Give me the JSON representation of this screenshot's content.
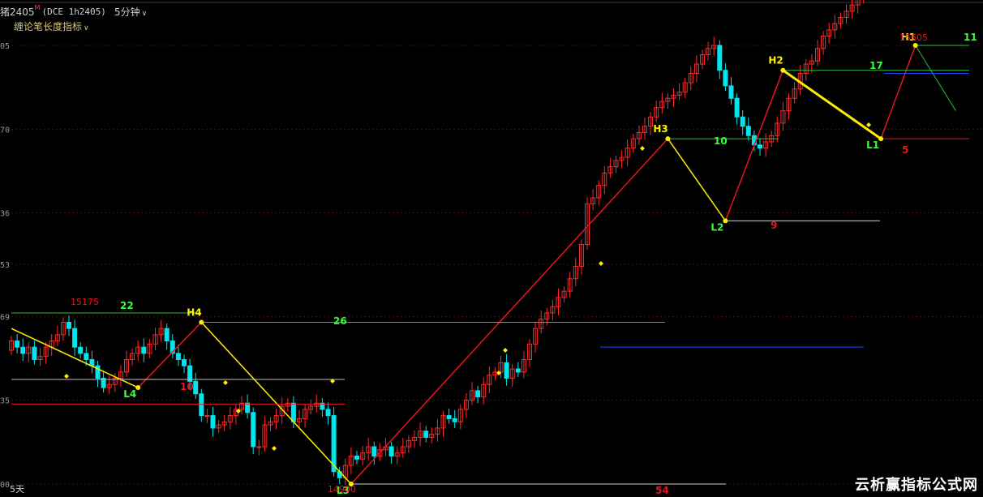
{
  "header": {
    "symbol": "猪2405",
    "symbol_flag": "M",
    "code": "(DCE 1h2405)",
    "period": "5分钟",
    "indicator": "缠论笔长度指标"
  },
  "footer": {
    "days": "5天"
  },
  "watermark": "云析赢指标公式网",
  "colors": {
    "up": "#ff2a2a",
    "down": "#00e5ee",
    "stroke_yellow": "#ffee00",
    "red_line": "#e8141e",
    "green_label": "#35ff35",
    "blue_line": "#2040ff"
  },
  "chart_data": {
    "type": "candlestick",
    "ylim": [
      14900,
      15605
    ],
    "y_ticks": [
      {
        "value": 15605,
        "label": "05"
      },
      {
        "value": 15470,
        "label": "70"
      },
      {
        "value": 15336,
        "label": "36"
      },
      {
        "value": 15253,
        "label": "53"
      },
      {
        "value": 15169,
        "label": "69"
      },
      {
        "value": 15035,
        "label": "35"
      },
      {
        "value": 14900,
        "label": "00"
      }
    ],
    "closes": [
      15130,
      15120,
      15110,
      15120,
      15100,
      15105,
      15120,
      15130,
      15140,
      15160,
      15150,
      15120,
      15110,
      15100,
      15090,
      15070,
      15055,
      15060,
      15070,
      15080,
      15100,
      15110,
      15120,
      15110,
      15125,
      15140,
      15150,
      15130,
      15110,
      15100,
      15090,
      15065,
      15045,
      15010,
      15010,
      14990,
      14995,
      15000,
      15010,
      15020,
      15030,
      15015,
      14960,
      14960,
      14995,
      15000,
      15010,
      15025,
      15030,
      15000,
      15005,
      15020,
      15025,
      15030,
      15020,
      15010,
      14920,
      14910,
      14930,
      14945,
      14940,
      14950,
      14960,
      14945,
      14955,
      14960,
      14945,
      14950,
      14960,
      14970,
      14975,
      14985,
      14975,
      14980,
      14990,
      15010,
      15005,
      15000,
      15020,
      15035,
      15050,
      15040,
      15060,
      15075,
      15080,
      15095,
      15070,
      15085,
      15080,
      15100,
      15125,
      15150,
      15165,
      15175,
      15185,
      15200,
      15210,
      15230,
      15250,
      15285,
      15350,
      15360,
      15380,
      15400,
      15410,
      15420,
      15425,
      15440,
      15455,
      15465,
      15475,
      15490,
      15505,
      15515,
      15520,
      15525,
      15530,
      15545,
      15560,
      15575,
      15590,
      15600,
      15605,
      15565,
      15540,
      15520,
      15490,
      15475,
      15460,
      15445,
      15440,
      15450,
      15460,
      15480,
      15500,
      15520,
      15535,
      15560,
      15575,
      15580,
      15600,
      15620,
      15630,
      15640,
      15650,
      15660,
      15670,
      15680,
      15690,
      15700,
      15710,
      15720,
      15730,
      15740,
      15750,
      15760,
      15770,
      15780,
      15790,
      15800,
      15810,
      15820,
      15830,
      15840,
      15850,
      15860,
      15870,
      15880,
      15890,
      15900
    ],
    "pivots": [
      {
        "label": "H4",
        "value": 15160
      },
      {
        "label": "L4",
        "value": 15055
      },
      {
        "label": "L3",
        "value": 14900
      },
      {
        "label": "H3",
        "value": 15455
      },
      {
        "label": "L2",
        "value": 15323
      },
      {
        "label": "H2",
        "value": 15565
      },
      {
        "label": "L1",
        "value": 15455
      },
      {
        "label": "H1",
        "value": 15605
      }
    ],
    "price_labels": [
      {
        "text": "15175",
        "value": 15175
      },
      {
        "text": "14900",
        "value": 14900
      },
      {
        "text": "15605",
        "value": 15605
      }
    ],
    "length_labels": [
      {
        "text": "22",
        "type": "up"
      },
      {
        "text": "10",
        "type": "down"
      },
      {
        "text": "26",
        "type": "up"
      },
      {
        "text": "54",
        "type": "down"
      },
      {
        "text": "10",
        "type": "up"
      },
      {
        "text": "9",
        "type": "down"
      },
      {
        "text": "17",
        "type": "up"
      },
      {
        "text": "5",
        "type": "down"
      },
      {
        "text": "11",
        "type": "up"
      }
    ]
  }
}
